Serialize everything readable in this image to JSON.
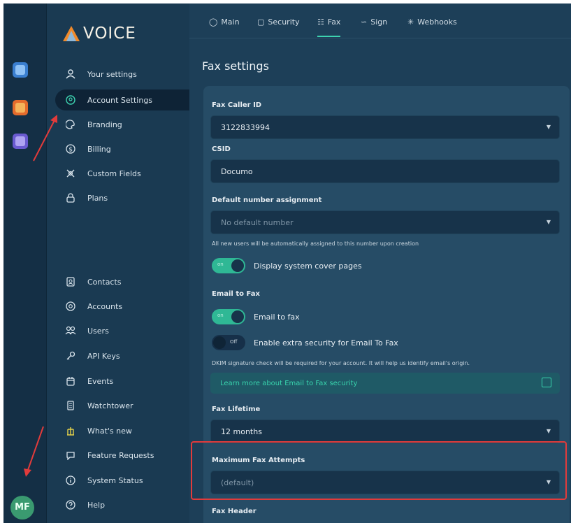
{
  "rail": {
    "apps": [
      {
        "name": "app-1",
        "color": "#3a7fd0",
        "accent": "#8fc2f5"
      },
      {
        "name": "app-2",
        "color": "#e46b2c",
        "accent": "#f4b35a"
      },
      {
        "name": "app-3",
        "color": "#6a5bd1",
        "accent": "#aea4f2"
      }
    ],
    "avatar_initials": "MF"
  },
  "logo": {
    "text": "VOICE"
  },
  "sidebar": {
    "items": [
      {
        "label": "Your settings",
        "icon": "user-icon"
      },
      {
        "label": "Account Settings",
        "icon": "account-circle-icon"
      },
      {
        "label": "Branding",
        "icon": "palette-icon"
      },
      {
        "label": "Billing",
        "icon": "dollar-icon"
      },
      {
        "label": "Custom Fields",
        "icon": "custom-fields-icon"
      },
      {
        "label": "Plans",
        "icon": "lock-icon"
      },
      {
        "label": "Contacts",
        "icon": "contact-card-icon"
      },
      {
        "label": "Accounts",
        "icon": "at-icon"
      },
      {
        "label": "Users",
        "icon": "users-icon"
      },
      {
        "label": "API Keys",
        "icon": "key-icon"
      },
      {
        "label": "Events",
        "icon": "calendar-icon"
      },
      {
        "label": "Watchtower",
        "icon": "watchtower-icon"
      },
      {
        "label": "What's new",
        "icon": "whats-new-icon"
      },
      {
        "label": "Feature Requests",
        "icon": "chat-icon"
      },
      {
        "label": "System Status",
        "icon": "info-icon"
      },
      {
        "label": "Help",
        "icon": "help-icon"
      }
    ]
  },
  "tabs": [
    {
      "label": "Main",
      "icon": "user-icon"
    },
    {
      "label": "Security",
      "icon": "lock-icon"
    },
    {
      "label": "Fax",
      "icon": "fax-icon"
    },
    {
      "label": "Sign",
      "icon": "sign-icon"
    },
    {
      "label": "Webhooks",
      "icon": "webhooks-icon"
    }
  ],
  "page": {
    "title": "Fax settings"
  },
  "form": {
    "fax_caller_id": {
      "label": "Fax Caller ID",
      "value": "3122833994"
    },
    "csid": {
      "label": "CSID",
      "value": "Documo"
    },
    "default_number": {
      "label": "Default number assignment",
      "placeholder": "No default number",
      "help": "All new users will be automatically assigned to this number upon creation"
    },
    "cover_pages": {
      "label": "Display system cover pages",
      "state": "on"
    },
    "email_to_fax_section": "Email to Fax",
    "email_to_fax": {
      "label": "Email to fax",
      "state": "on"
    },
    "extra_security": {
      "label": "Enable extra security for Email To Fax",
      "state": "Off"
    },
    "dkim_help": "DKIM signature check will be required for your account. It will help us identify email's origin.",
    "learn_more": "Learn more about Email to Fax security",
    "fax_lifetime": {
      "label": "Fax Lifetime",
      "value": "12 months"
    },
    "max_attempts": {
      "label": "Maximum Fax Attempts",
      "placeholder": "(default)"
    },
    "fax_header": {
      "label": "Fax Header"
    }
  },
  "colors": {
    "accent": "#3dd3b0",
    "highlight": "#e23b3b"
  }
}
